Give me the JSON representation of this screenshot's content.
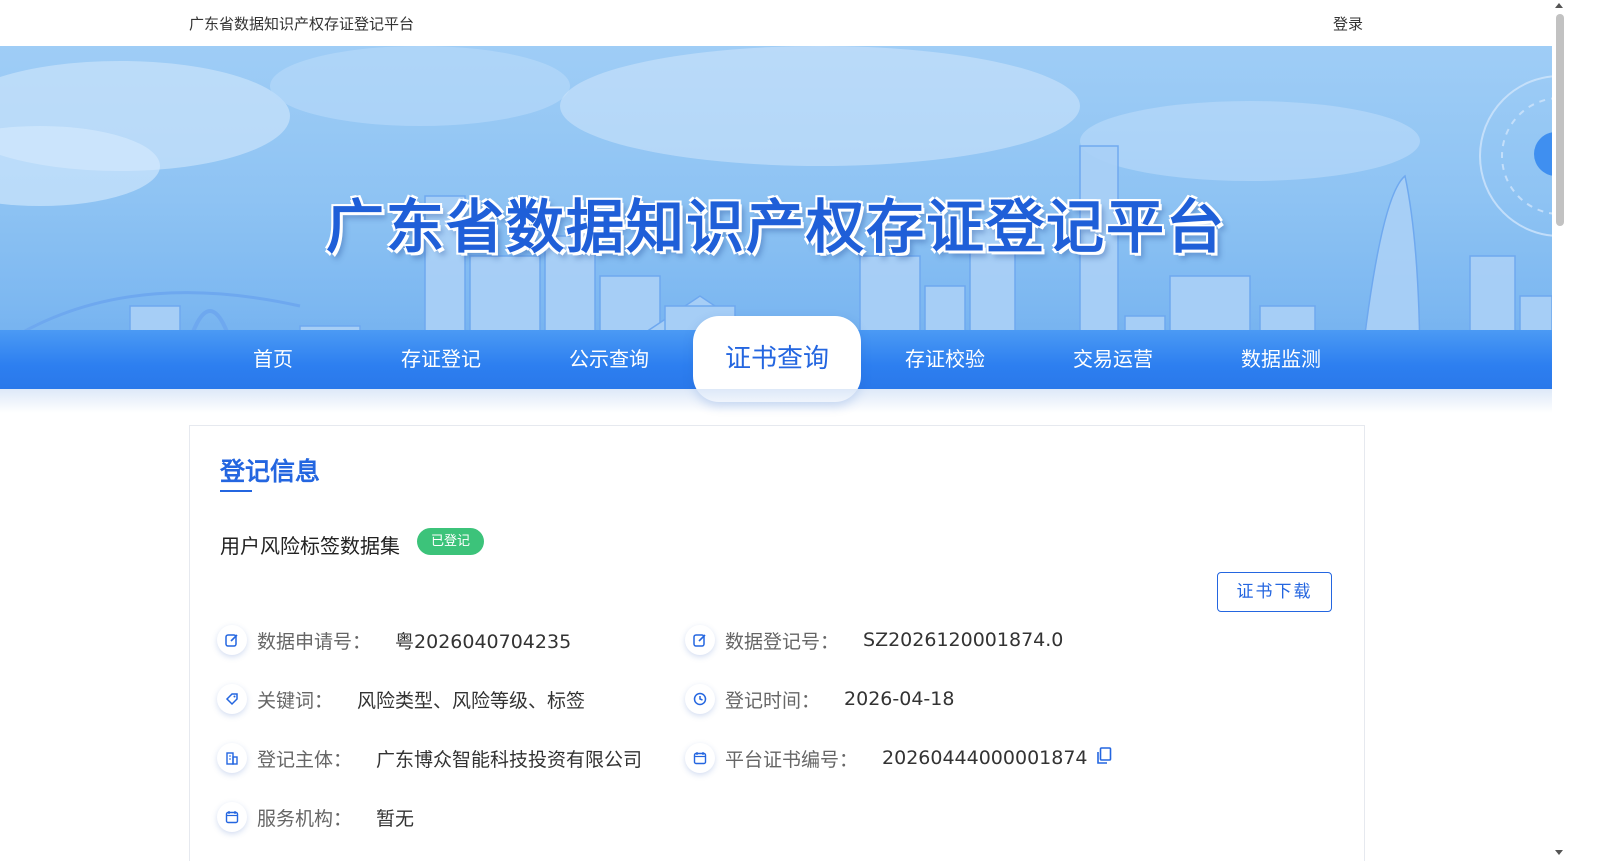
{
  "header": {
    "site_name": "广东省数据知识产权存证登记平台",
    "login": "登录"
  },
  "banner": {
    "title": "广东省数据知识产权存证登记平台"
  },
  "nav": {
    "items": [
      {
        "label": "首页"
      },
      {
        "label": "存证登记"
      },
      {
        "label": "公示查询"
      },
      {
        "label": "证书查询"
      },
      {
        "label": "存证校验"
      },
      {
        "label": "交易运营"
      },
      {
        "label": "数据监测"
      }
    ],
    "active": "证书查询"
  },
  "registration": {
    "section_title": "登记信息",
    "dataset_name": "用户风险标签数据集",
    "status": "已登记",
    "download_label": "证书下载",
    "fields": {
      "application_no": {
        "label": "数据申请号：",
        "value": "粤2026040704235",
        "icon": "edit-icon"
      },
      "registration_no": {
        "label": "数据登记号：",
        "value": "SZ2026120001874.0",
        "icon": "edit-icon"
      },
      "keywords": {
        "label": "关键词：",
        "value": "风险类型、风险等级、标签",
        "icon": "tag-icon"
      },
      "registration_time": {
        "label": "登记时间：",
        "value": "2026-04-18",
        "icon": "clock-icon"
      },
      "registrant": {
        "label": "登记主体：",
        "value": "广东博众智能科技投资有限公司",
        "icon": "building-icon"
      },
      "certificate_no": {
        "label": "平台证书编号：",
        "value": "20260444000001874",
        "icon": "calendar-icon"
      },
      "service_org": {
        "label": "服务机构：",
        "value": "暂无",
        "icon": "calendar-icon"
      }
    }
  },
  "colors": {
    "primary": "#2466e0",
    "status_green": "#3cc37a",
    "nav_blue": "#2d7ff0"
  }
}
